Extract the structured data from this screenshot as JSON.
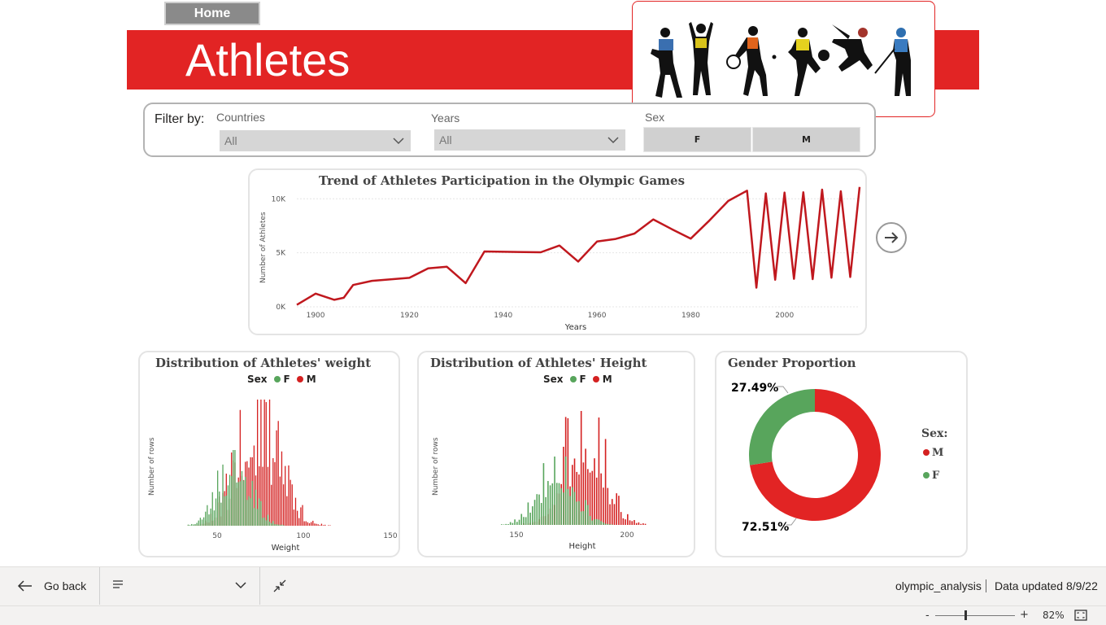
{
  "nav": {
    "home_label": "Home"
  },
  "header": {
    "title": "Athletes"
  },
  "filters": {
    "title": "Filter by:",
    "countries": {
      "label": "Countries",
      "value": "All"
    },
    "years": {
      "label": "Years",
      "value": "All"
    },
    "sex": {
      "label": "Sex",
      "options": [
        "F",
        "M"
      ]
    }
  },
  "colors": {
    "brand": "#e22424",
    "male": "#d42121",
    "female": "#58a55c",
    "line": "#c0181e"
  },
  "trend": {
    "title": "Trend of Athletes Participation in the Olympic Games",
    "xlabel": "Years",
    "ylabel": "Number of Athletes",
    "yticks": [
      "0K",
      "5K",
      "10K"
    ],
    "xticks": [
      "1900",
      "1920",
      "1940",
      "1960",
      "1980",
      "2000"
    ]
  },
  "weight": {
    "title": "Distribution of Athletes' weight",
    "legend_title": "Sex",
    "legend": [
      "F",
      "M"
    ],
    "xlabel": "Weight",
    "ylabel": "Number of rows",
    "xticks": [
      "50",
      "100",
      "150"
    ]
  },
  "height": {
    "title": "Distribution of Athletes' Height",
    "legend_title": "Sex",
    "legend": [
      "F",
      "M"
    ],
    "xlabel": "Height",
    "ylabel": "Number of rows",
    "xticks": [
      "150",
      "200"
    ]
  },
  "gender": {
    "title": "Gender Proportion",
    "legend_title": "Sex:",
    "legend": [
      "M",
      "F"
    ],
    "female_label": "27.49%",
    "male_label": "72.51%"
  },
  "chart_data": [
    {
      "type": "line",
      "title": "Trend of Athletes Participation in the Olympic Games",
      "xlabel": "Years",
      "ylabel": "Number of Athletes",
      "ylim": [
        0,
        11000
      ],
      "xlim": [
        1896,
        2016
      ],
      "x": [
        1896,
        1900,
        1904,
        1906,
        1908,
        1912,
        1920,
        1924,
        1928,
        1932,
        1936,
        1948,
        1952,
        1956,
        1960,
        1964,
        1968,
        1972,
        1976,
        1980,
        1984,
        1988,
        1992,
        1994,
        1996,
        1998,
        2000,
        2002,
        2004,
        2006,
        2008,
        2010,
        2012,
        2014,
        2016
      ],
      "y": [
        180,
        1220,
        650,
        840,
        2020,
        2400,
        2680,
        3560,
        3710,
        2190,
        5120,
        5050,
        5670,
        4190,
        6040,
        6280,
        6780,
        8090,
        7180,
        6310,
        8000,
        9800,
        10750,
        1770,
        10500,
        2500,
        10580,
        2590,
        10600,
        2560,
        10850,
        2700,
        10700,
        2760,
        11100
      ]
    },
    {
      "type": "bar",
      "title": "Distribution of Athletes' weight",
      "xlabel": "Weight",
      "ylabel": "Number of rows",
      "xlim": [
        25,
        150
      ],
      "series": [
        {
          "name": "F"
        },
        {
          "name": "M"
        }
      ]
    },
    {
      "type": "bar",
      "title": "Distribution of Athletes' Height",
      "xlabel": "Height",
      "ylabel": "Number of rows",
      "xlim": [
        130,
        225
      ],
      "series": [
        {
          "name": "F"
        },
        {
          "name": "M"
        }
      ]
    },
    {
      "type": "pie",
      "title": "Gender Proportion",
      "categories": [
        "M",
        "F"
      ],
      "values": [
        72.51,
        27.49
      ]
    }
  ],
  "footer": {
    "back_label": "Go back",
    "report_name": "olympic_analysis",
    "updated": "Data updated 8/9/22",
    "zoom": "82%",
    "zoom_minus": "-",
    "zoom_plus": "+"
  }
}
